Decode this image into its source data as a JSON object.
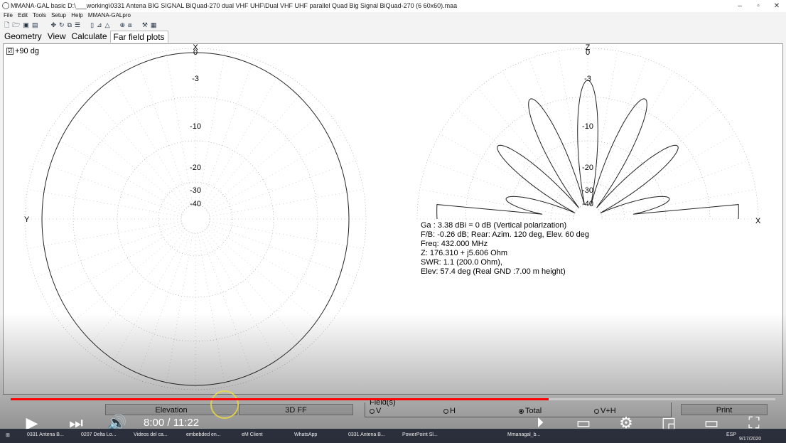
{
  "window": {
    "title": "MMANA-GAL basic D:\\___working\\0331 Antena BIG SIGNAL BiQuad-270 dual VHF UHF\\Dual VHF UHF parallel Quad Big Signal BiQuad-270 (6 60x60).maa",
    "minimize": "–",
    "maximize": "▫",
    "close": "✕"
  },
  "menu": [
    "File",
    "Edit",
    "Tools",
    "Setup",
    "Help",
    "MMANA-GALpro"
  ],
  "toolbar_icons": [
    "new-file-icon",
    "open-folder-icon",
    "save-icon",
    "print-icon",
    "move-icon",
    "rotate-icon",
    "copy-icon",
    "list-icon",
    "table-icon",
    "chart-icon",
    "triangle-icon",
    "target-icon",
    "clone-icon",
    "tools-icon",
    "calc-icon"
  ],
  "tabs": [
    "Geometry",
    "View",
    "Calculate",
    "Far field plots"
  ],
  "active_tab": 3,
  "plot": {
    "checkbox_label": "+90 dg",
    "checkbox_mark": "☑",
    "left": {
      "top_axis": "X",
      "side_axis": "Y",
      "ring_labels": [
        "0",
        "-3",
        "-10",
        "-20",
        "-30",
        "-40"
      ]
    },
    "right": {
      "top_axis": "Z",
      "side_axis": "X",
      "ring_labels": [
        "0",
        "-3",
        "-10",
        "-20",
        "-30",
        "-40"
      ]
    },
    "info": [
      "Ga : 3.38 dBi = 0 dB  (Vertical polarization)",
      "F/B: -0.26 dB; Rear: Azim. 120 deg,  Elev. 60 deg",
      "Freq: 432.000 MHz",
      "Z: 176.310 + j5.606 Ohm",
      "SWR: 1.1 (200.0 Ohm),",
      "Elev: 57.4 deg (Real GND  :7.00 m height)"
    ]
  },
  "bottom": {
    "elevation_button": "Elevation",
    "ff3d_button": "3D FF",
    "field_label": "Field(s)",
    "radios": [
      {
        "label": "V",
        "selected": false
      },
      {
        "label": "H",
        "selected": false
      },
      {
        "label": "Total",
        "selected": true
      },
      {
        "label": "V+H",
        "selected": false
      }
    ],
    "print_button": "Print"
  },
  "player": {
    "time": "8:00 / 11:22",
    "progress_fraction": 0.7038
  },
  "taskbar": [
    "0331 Antena B...",
    "0207 Delta Lo...",
    "Videos del ca...",
    "embebded en...",
    "eM Client",
    "WhatsApp",
    "0331 Antena B...",
    "PowerPoint Sl...",
    "Mmanagal_b...",
    "ESP",
    "9/17/2020"
  ]
}
